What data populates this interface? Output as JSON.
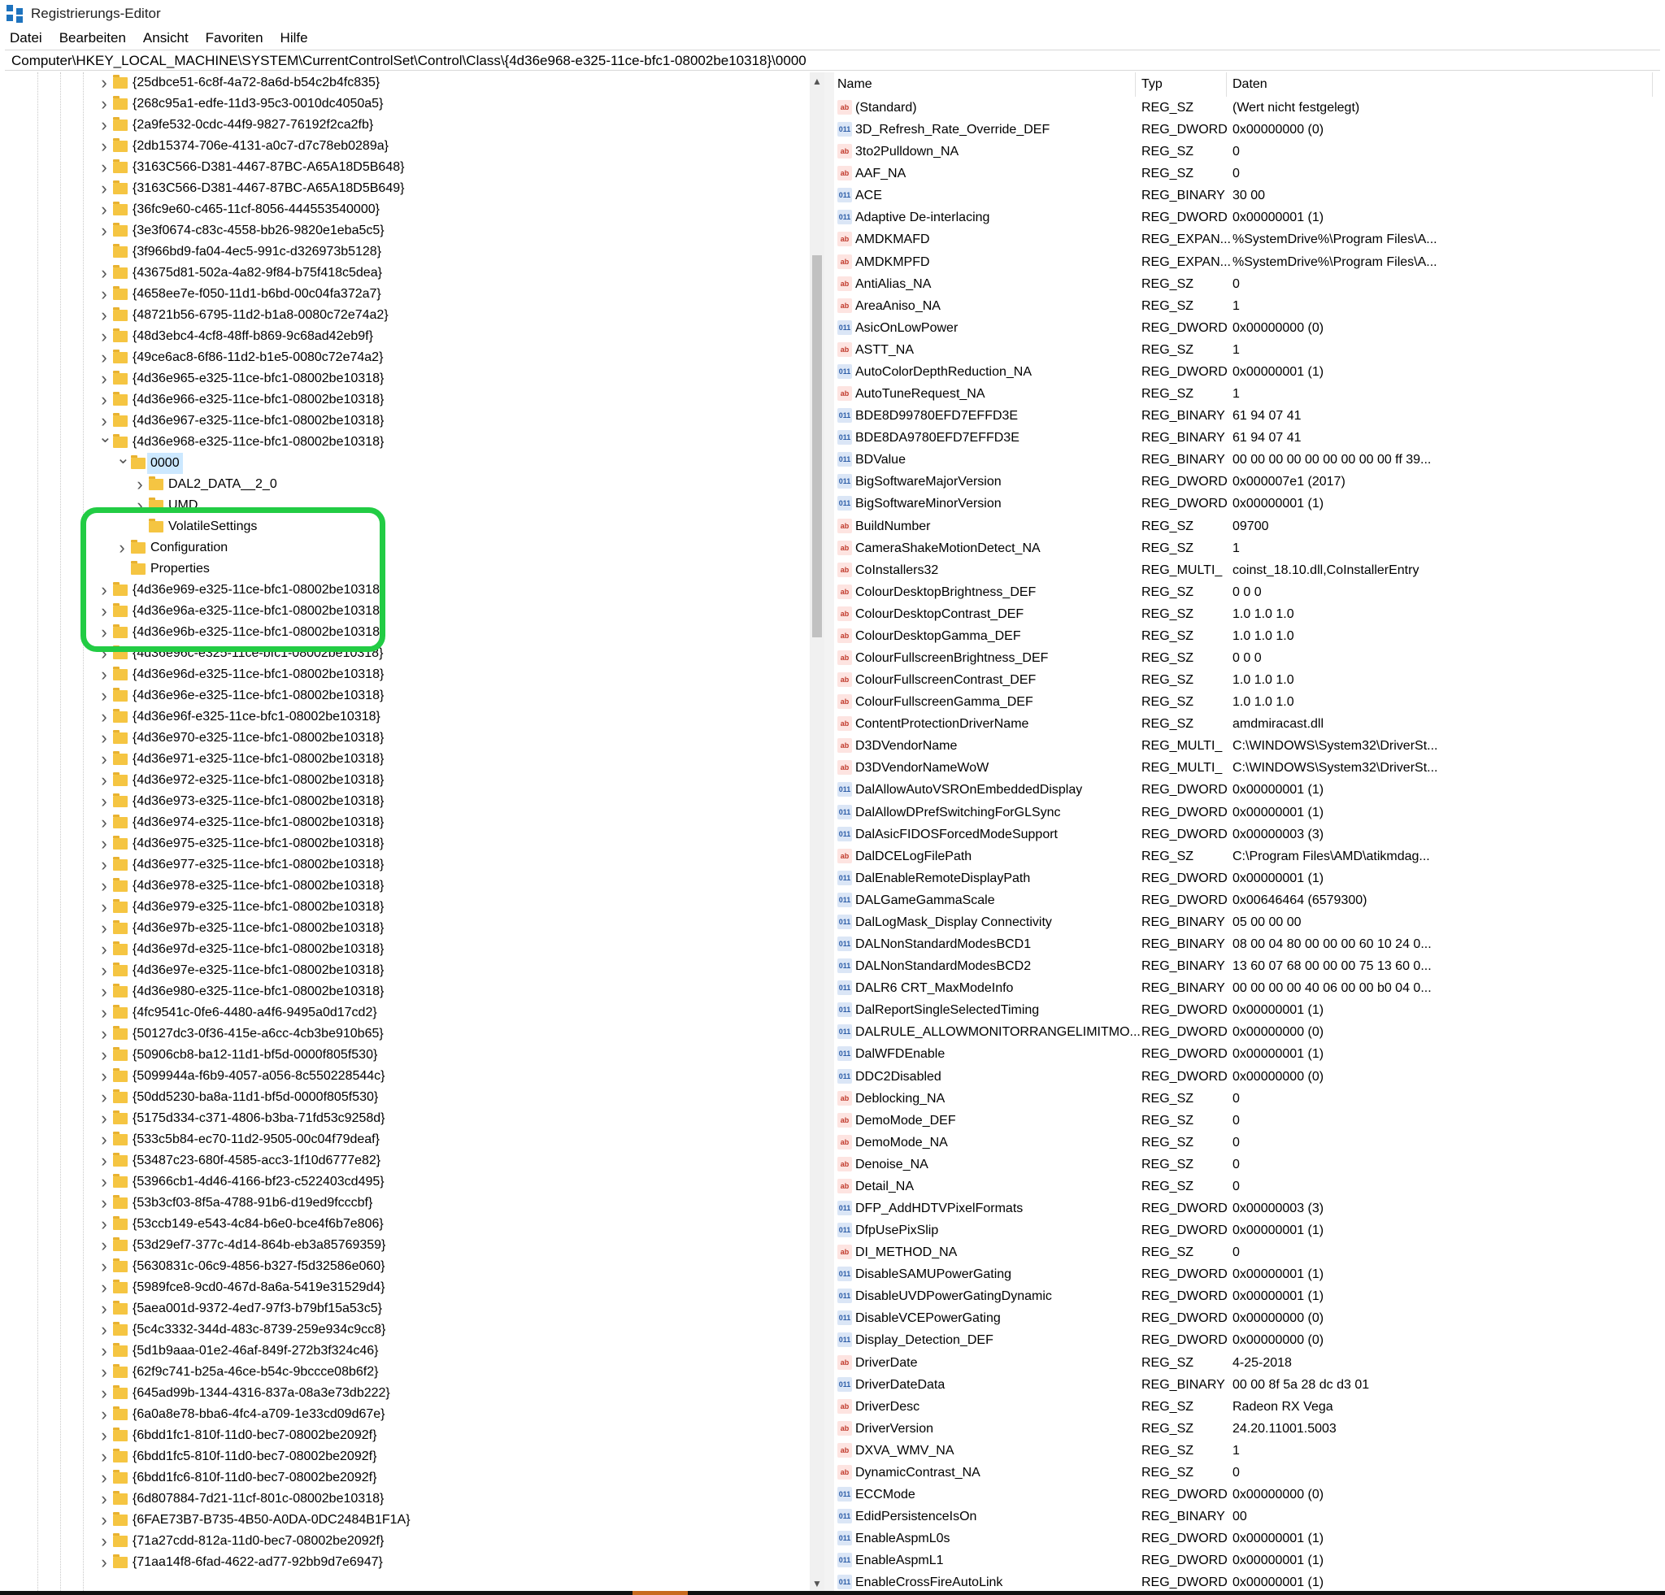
{
  "window": {
    "title": "Registrierungs-Editor"
  },
  "menu": [
    "Datei",
    "Bearbeiten",
    "Ansicht",
    "Favoriten",
    "Hilfe"
  ],
  "address": "Computer\\HKEY_LOCAL_MACHINE\\SYSTEM\\CurrentControlSet\\Control\\Class\\{4d36e968-e325-11ce-bfc1-08002be10318}\\0000",
  "tree": [
    {
      "label": "{25dbce51-6c8f-4a72-8a6d-b54c2b4fc835}",
      "depth": 0,
      "exp": "c"
    },
    {
      "label": "{268c95a1-edfe-11d3-95c3-0010dc4050a5}",
      "depth": 0,
      "exp": "c"
    },
    {
      "label": "{2a9fe532-0cdc-44f9-9827-76192f2ca2fb}",
      "depth": 0,
      "exp": "c"
    },
    {
      "label": "{2db15374-706e-4131-a0c7-d7c78eb0289a}",
      "depth": 0,
      "exp": "c"
    },
    {
      "label": "{3163C566-D381-4467-87BC-A65A18D5B648}",
      "depth": 0,
      "exp": "c"
    },
    {
      "label": "{3163C566-D381-4467-87BC-A65A18D5B649}",
      "depth": 0,
      "exp": "c"
    },
    {
      "label": "{36fc9e60-c465-11cf-8056-444553540000}",
      "depth": 0,
      "exp": "c"
    },
    {
      "label": "{3e3f0674-c83c-4558-bb26-9820e1eba5c5}",
      "depth": 0,
      "exp": "c"
    },
    {
      "label": "{3f966bd9-fa04-4ec5-991c-d326973b5128}",
      "depth": 0,
      "exp": "n"
    },
    {
      "label": "{43675d81-502a-4a82-9f84-b75f418c5dea}",
      "depth": 0,
      "exp": "c"
    },
    {
      "label": "{4658ee7e-f050-11d1-b6bd-00c04fa372a7}",
      "depth": 0,
      "exp": "c"
    },
    {
      "label": "{48721b56-6795-11d2-b1a8-0080c72e74a2}",
      "depth": 0,
      "exp": "c"
    },
    {
      "label": "{48d3ebc4-4cf8-48ff-b869-9c68ad42eb9f}",
      "depth": 0,
      "exp": "c"
    },
    {
      "label": "{49ce6ac8-6f86-11d2-b1e5-0080c72e74a2}",
      "depth": 0,
      "exp": "c"
    },
    {
      "label": "{4d36e965-e325-11ce-bfc1-08002be10318}",
      "depth": 0,
      "exp": "c"
    },
    {
      "label": "{4d36e966-e325-11ce-bfc1-08002be10318}",
      "depth": 0,
      "exp": "c"
    },
    {
      "label": "{4d36e967-e325-11ce-bfc1-08002be10318}",
      "depth": 0,
      "exp": "c"
    },
    {
      "label": "{4d36e968-e325-11ce-bfc1-08002be10318}",
      "depth": 0,
      "exp": "e"
    },
    {
      "label": "0000",
      "depth": 1,
      "exp": "e",
      "selected": true
    },
    {
      "label": "DAL2_DATA__2_0",
      "depth": 2,
      "exp": "c"
    },
    {
      "label": "UMD",
      "depth": 2,
      "exp": "c"
    },
    {
      "label": "VolatileSettings",
      "depth": 2,
      "exp": "n"
    },
    {
      "label": "Configuration",
      "depth": 1,
      "exp": "c"
    },
    {
      "label": "Properties",
      "depth": 1,
      "exp": "n"
    },
    {
      "label": "{4d36e969-e325-11ce-bfc1-08002be10318}",
      "depth": 0,
      "exp": "c"
    },
    {
      "label": "{4d36e96a-e325-11ce-bfc1-08002be10318}",
      "depth": 0,
      "exp": "c"
    },
    {
      "label": "{4d36e96b-e325-11ce-bfc1-08002be10318}",
      "depth": 0,
      "exp": "c"
    },
    {
      "label": "{4d36e96c-e325-11ce-bfc1-08002be10318}",
      "depth": 0,
      "exp": "c"
    },
    {
      "label": "{4d36e96d-e325-11ce-bfc1-08002be10318}",
      "depth": 0,
      "exp": "c"
    },
    {
      "label": "{4d36e96e-e325-11ce-bfc1-08002be10318}",
      "depth": 0,
      "exp": "c"
    },
    {
      "label": "{4d36e96f-e325-11ce-bfc1-08002be10318}",
      "depth": 0,
      "exp": "c"
    },
    {
      "label": "{4d36e970-e325-11ce-bfc1-08002be10318}",
      "depth": 0,
      "exp": "c"
    },
    {
      "label": "{4d36e971-e325-11ce-bfc1-08002be10318}",
      "depth": 0,
      "exp": "c"
    },
    {
      "label": "{4d36e972-e325-11ce-bfc1-08002be10318}",
      "depth": 0,
      "exp": "c"
    },
    {
      "label": "{4d36e973-e325-11ce-bfc1-08002be10318}",
      "depth": 0,
      "exp": "c"
    },
    {
      "label": "{4d36e974-e325-11ce-bfc1-08002be10318}",
      "depth": 0,
      "exp": "c"
    },
    {
      "label": "{4d36e975-e325-11ce-bfc1-08002be10318}",
      "depth": 0,
      "exp": "c"
    },
    {
      "label": "{4d36e977-e325-11ce-bfc1-08002be10318}",
      "depth": 0,
      "exp": "c"
    },
    {
      "label": "{4d36e978-e325-11ce-bfc1-08002be10318}",
      "depth": 0,
      "exp": "c"
    },
    {
      "label": "{4d36e979-e325-11ce-bfc1-08002be10318}",
      "depth": 0,
      "exp": "c"
    },
    {
      "label": "{4d36e97b-e325-11ce-bfc1-08002be10318}",
      "depth": 0,
      "exp": "c"
    },
    {
      "label": "{4d36e97d-e325-11ce-bfc1-08002be10318}",
      "depth": 0,
      "exp": "c"
    },
    {
      "label": "{4d36e97e-e325-11ce-bfc1-08002be10318}",
      "depth": 0,
      "exp": "c"
    },
    {
      "label": "{4d36e980-e325-11ce-bfc1-08002be10318}",
      "depth": 0,
      "exp": "c"
    },
    {
      "label": "{4fc9541c-0fe6-4480-a4f6-9495a0d17cd2}",
      "depth": 0,
      "exp": "c"
    },
    {
      "label": "{50127dc3-0f36-415e-a6cc-4cb3be910b65}",
      "depth": 0,
      "exp": "c"
    },
    {
      "label": "{50906cb8-ba12-11d1-bf5d-0000f805f530}",
      "depth": 0,
      "exp": "c"
    },
    {
      "label": "{5099944a-f6b9-4057-a056-8c550228544c}",
      "depth": 0,
      "exp": "c"
    },
    {
      "label": "{50dd5230-ba8a-11d1-bf5d-0000f805f530}",
      "depth": 0,
      "exp": "c"
    },
    {
      "label": "{5175d334-c371-4806-b3ba-71fd53c9258d}",
      "depth": 0,
      "exp": "c"
    },
    {
      "label": "{533c5b84-ec70-11d2-9505-00c04f79deaf}",
      "depth": 0,
      "exp": "c"
    },
    {
      "label": "{53487c23-680f-4585-acc3-1f10d6777e82}",
      "depth": 0,
      "exp": "c"
    },
    {
      "label": "{53966cb1-4d46-4166-bf23-c522403cd495}",
      "depth": 0,
      "exp": "c"
    },
    {
      "label": "{53b3cf03-8f5a-4788-91b6-d19ed9fcccbf}",
      "depth": 0,
      "exp": "c"
    },
    {
      "label": "{53ccb149-e543-4c84-b6e0-bce4f6b7e806}",
      "depth": 0,
      "exp": "c"
    },
    {
      "label": "{53d29ef7-377c-4d14-864b-eb3a85769359}",
      "depth": 0,
      "exp": "c"
    },
    {
      "label": "{5630831c-06c9-4856-b327-f5d32586e060}",
      "depth": 0,
      "exp": "c"
    },
    {
      "label": "{5989fce8-9cd0-467d-8a6a-5419e31529d4}",
      "depth": 0,
      "exp": "c"
    },
    {
      "label": "{5aea001d-9372-4ed7-97f3-b79bf15a53c5}",
      "depth": 0,
      "exp": "c"
    },
    {
      "label": "{5c4c3332-344d-483c-8739-259e934c9cc8}",
      "depth": 0,
      "exp": "c"
    },
    {
      "label": "{5d1b9aaa-01e2-46af-849f-272b3f324c46}",
      "depth": 0,
      "exp": "c"
    },
    {
      "label": "{62f9c741-b25a-46ce-b54c-9bccce08b6f2}",
      "depth": 0,
      "exp": "c"
    },
    {
      "label": "{645ad99b-1344-4316-837a-08a3e73db222}",
      "depth": 0,
      "exp": "c"
    },
    {
      "label": "{6a0a8e78-bba6-4fc4-a709-1e33cd09d67e}",
      "depth": 0,
      "exp": "c"
    },
    {
      "label": "{6bdd1fc1-810f-11d0-bec7-08002be2092f}",
      "depth": 0,
      "exp": "c"
    },
    {
      "label": "{6bdd1fc5-810f-11d0-bec7-08002be2092f}",
      "depth": 0,
      "exp": "c"
    },
    {
      "label": "{6bdd1fc6-810f-11d0-bec7-08002be2092f}",
      "depth": 0,
      "exp": "c"
    },
    {
      "label": "{6d807884-7d21-11cf-801c-08002be10318}",
      "depth": 0,
      "exp": "c"
    },
    {
      "label": "{6FAE73B7-B735-4B50-A0DA-0DC2484B1F1A}",
      "depth": 0,
      "exp": "c"
    },
    {
      "label": "{71a27cdd-812a-11d0-bec7-08002be2092f}",
      "depth": 0,
      "exp": "c"
    },
    {
      "label": "{71aa14f8-6fad-4622-ad77-92bb9d7e6947}",
      "depth": 0,
      "exp": "c"
    }
  ],
  "columns": {
    "name": "Name",
    "type": "Typ",
    "data": "Daten"
  },
  "values": [
    {
      "n": "(Standard)",
      "t": "REG_SZ",
      "d": "(Wert nicht festgelegt)"
    },
    {
      "n": "3D_Refresh_Rate_Override_DEF",
      "t": "REG_DWORD",
      "d": "0x00000000 (0)"
    },
    {
      "n": "3to2Pulldown_NA",
      "t": "REG_SZ",
      "d": "0"
    },
    {
      "n": "AAF_NA",
      "t": "REG_SZ",
      "d": "0"
    },
    {
      "n": "ACE",
      "t": "REG_BINARY",
      "d": "30 00"
    },
    {
      "n": "Adaptive De-interlacing",
      "t": "REG_DWORD",
      "d": "0x00000001 (1)"
    },
    {
      "n": "AMDKMAFD",
      "t": "REG_EXPAN...",
      "d": "%SystemDrive%\\Program Files\\A..."
    },
    {
      "n": "AMDKMPFD",
      "t": "REG_EXPAN...",
      "d": "%SystemDrive%\\Program Files\\A..."
    },
    {
      "n": "AntiAlias_NA",
      "t": "REG_SZ",
      "d": "0"
    },
    {
      "n": "AreaAniso_NA",
      "t": "REG_SZ",
      "d": "1"
    },
    {
      "n": "AsicOnLowPower",
      "t": "REG_DWORD",
      "d": "0x00000000 (0)"
    },
    {
      "n": "ASTT_NA",
      "t": "REG_SZ",
      "d": "1"
    },
    {
      "n": "AutoColorDepthReduction_NA",
      "t": "REG_DWORD",
      "d": "0x00000001 (1)"
    },
    {
      "n": "AutoTuneRequest_NA",
      "t": "REG_SZ",
      "d": "1"
    },
    {
      "n": "BDE8D99780EFD7EFFD3E",
      "t": "REG_BINARY",
      "d": "61 94 07 41"
    },
    {
      "n": "BDE8DA9780EFD7EFFD3E",
      "t": "REG_BINARY",
      "d": "61 94 07 41"
    },
    {
      "n": "BDValue",
      "t": "REG_BINARY",
      "d": "00 00 00 00 00 00 00 00 00 ff 39..."
    },
    {
      "n": "BigSoftwareMajorVersion",
      "t": "REG_DWORD",
      "d": "0x000007e1 (2017)"
    },
    {
      "n": "BigSoftwareMinorVersion",
      "t": "REG_DWORD",
      "d": "0x00000001 (1)"
    },
    {
      "n": "BuildNumber",
      "t": "REG_SZ",
      "d": "09700"
    },
    {
      "n": "CameraShakeMotionDetect_NA",
      "t": "REG_SZ",
      "d": "1"
    },
    {
      "n": "CoInstallers32",
      "t": "REG_MULTI_",
      "d": "coinst_18.10.dll,CoInstallerEntry"
    },
    {
      "n": "ColourDesktopBrightness_DEF",
      "t": "REG_SZ",
      "d": "0 0 0"
    },
    {
      "n": "ColourDesktopContrast_DEF",
      "t": "REG_SZ",
      "d": "1.0 1.0 1.0"
    },
    {
      "n": "ColourDesktopGamma_DEF",
      "t": "REG_SZ",
      "d": "1.0 1.0 1.0"
    },
    {
      "n": "ColourFullscreenBrightness_DEF",
      "t": "REG_SZ",
      "d": "0 0 0"
    },
    {
      "n": "ColourFullscreenContrast_DEF",
      "t": "REG_SZ",
      "d": "1.0 1.0 1.0"
    },
    {
      "n": "ColourFullscreenGamma_DEF",
      "t": "REG_SZ",
      "d": "1.0 1.0 1.0"
    },
    {
      "n": "ContentProtectionDriverName",
      "t": "REG_SZ",
      "d": "amdmiracast.dll"
    },
    {
      "n": "D3DVendorName",
      "t": "REG_MULTI_",
      "d": "C:\\WINDOWS\\System32\\DriverSt..."
    },
    {
      "n": "D3DVendorNameWoW",
      "t": "REG_MULTI_",
      "d": "C:\\WINDOWS\\System32\\DriverSt..."
    },
    {
      "n": "DalAllowAutoVSROnEmbeddedDisplay",
      "t": "REG_DWORD",
      "d": "0x00000001 (1)"
    },
    {
      "n": "DalAllowDPrefSwitchingForGLSync",
      "t": "REG_DWORD",
      "d": "0x00000001 (1)"
    },
    {
      "n": "DalAsicFIDOSForcedModeSupport",
      "t": "REG_DWORD",
      "d": "0x00000003 (3)"
    },
    {
      "n": "DalDCELogFilePath",
      "t": "REG_SZ",
      "d": "C:\\Program Files\\AMD\\atikmdag..."
    },
    {
      "n": "DalEnableRemoteDisplayPath",
      "t": "REG_DWORD",
      "d": "0x00000001 (1)"
    },
    {
      "n": "DALGameGammaScale",
      "t": "REG_DWORD",
      "d": "0x00646464 (6579300)"
    },
    {
      "n": "DalLogMask_Display Connectivity",
      "t": "REG_BINARY",
      "d": "05 00 00 00"
    },
    {
      "n": "DALNonStandardModesBCD1",
      "t": "REG_BINARY",
      "d": "08 00 04 80 00 00 00 60 10 24 0..."
    },
    {
      "n": "DALNonStandardModesBCD2",
      "t": "REG_BINARY",
      "d": "13 60 07 68 00 00 00 75 13 60 0..."
    },
    {
      "n": "DALR6 CRT_MaxModeInfo",
      "t": "REG_BINARY",
      "d": "00 00 00 00 40 06 00 00 b0 04 0..."
    },
    {
      "n": "DalReportSingleSelectedTiming",
      "t": "REG_DWORD",
      "d": "0x00000001 (1)"
    },
    {
      "n": "DALRULE_ALLOWMONITORRANGELIMITMO...",
      "t": "REG_DWORD",
      "d": "0x00000000 (0)"
    },
    {
      "n": "DalWFDEnable",
      "t": "REG_DWORD",
      "d": "0x00000001 (1)"
    },
    {
      "n": "DDC2Disabled",
      "t": "REG_DWORD",
      "d": "0x00000000 (0)"
    },
    {
      "n": "Deblocking_NA",
      "t": "REG_SZ",
      "d": "0"
    },
    {
      "n": "DemoMode_DEF",
      "t": "REG_SZ",
      "d": "0"
    },
    {
      "n": "DemoMode_NA",
      "t": "REG_SZ",
      "d": "0"
    },
    {
      "n": "Denoise_NA",
      "t": "REG_SZ",
      "d": "0"
    },
    {
      "n": "Detail_NA",
      "t": "REG_SZ",
      "d": "0"
    },
    {
      "n": "DFP_AddHDTVPixelFormats",
      "t": "REG_DWORD",
      "d": "0x00000003 (3)"
    },
    {
      "n": "DfpUsePixSlip",
      "t": "REG_DWORD",
      "d": "0x00000001 (1)"
    },
    {
      "n": "DI_METHOD_NA",
      "t": "REG_SZ",
      "d": "0"
    },
    {
      "n": "DisableSAMUPowerGating",
      "t": "REG_DWORD",
      "d": "0x00000001 (1)"
    },
    {
      "n": "DisableUVDPowerGatingDynamic",
      "t": "REG_DWORD",
      "d": "0x00000001 (1)"
    },
    {
      "n": "DisableVCEPowerGating",
      "t": "REG_DWORD",
      "d": "0x00000000 (0)"
    },
    {
      "n": "Display_Detection_DEF",
      "t": "REG_DWORD",
      "d": "0x00000000 (0)"
    },
    {
      "n": "DriverDate",
      "t": "REG_SZ",
      "d": "4-25-2018"
    },
    {
      "n": "DriverDateData",
      "t": "REG_BINARY",
      "d": "00 00 8f 5a 28 dc d3 01"
    },
    {
      "n": "DriverDesc",
      "t": "REG_SZ",
      "d": "Radeon RX Vega"
    },
    {
      "n": "DriverVersion",
      "t": "REG_SZ",
      "d": "24.20.11001.5003"
    },
    {
      "n": "DXVA_WMV_NA",
      "t": "REG_SZ",
      "d": "1"
    },
    {
      "n": "DynamicContrast_NA",
      "t": "REG_SZ",
      "d": "0"
    },
    {
      "n": "ECCMode",
      "t": "REG_DWORD",
      "d": "0x00000000 (0)"
    },
    {
      "n": "EdidPersistenceIsOn",
      "t": "REG_BINARY",
      "d": "00"
    },
    {
      "n": "EnableAspmL0s",
      "t": "REG_DWORD",
      "d": "0x00000001 (1)"
    },
    {
      "n": "EnableAspmL1",
      "t": "REG_DWORD",
      "d": "0x00000001 (1)"
    },
    {
      "n": "EnableCrossFireAutoLink",
      "t": "REG_DWORD",
      "d": "0x00000001 (1)"
    }
  ],
  "icons": {
    "string": "ab",
    "binary": "011"
  },
  "colors": {
    "highlight": "#22cc44",
    "selection": "#cce8ff",
    "folder": "#f5c542"
  }
}
